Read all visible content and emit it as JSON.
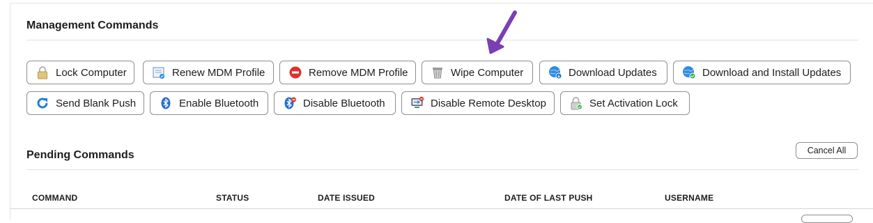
{
  "management": {
    "title": "Management Commands",
    "buttons": [
      {
        "label": "Lock Computer",
        "icon": "lock-icon"
      },
      {
        "label": "Renew MDM Profile",
        "icon": "certificate-icon"
      },
      {
        "label": "Remove MDM Profile",
        "icon": "no-entry-icon"
      },
      {
        "label": "Wipe Computer",
        "icon": "trash-icon"
      },
      {
        "label": "Download Updates",
        "icon": "globe-download-icon"
      },
      {
        "label": "Download and Install Updates",
        "icon": "globe-install-icon"
      },
      {
        "label": "Send Blank Push",
        "icon": "refresh-icon"
      },
      {
        "label": "Enable Bluetooth",
        "icon": "bluetooth-icon"
      },
      {
        "label": "Disable Bluetooth",
        "icon": "bluetooth-disabled-icon"
      },
      {
        "label": "Disable Remote Desktop",
        "icon": "remote-desktop-disabled-icon"
      },
      {
        "label": "Set Activation Lock",
        "icon": "activation-lock-icon"
      }
    ]
  },
  "pending": {
    "title": "Pending Commands",
    "cancel_all_label": "Cancel All",
    "columns": [
      "COMMAND",
      "STATUS",
      "DATE ISSUED",
      "DATE OF LAST PUSH",
      "USERNAME"
    ]
  },
  "annotation": {
    "arrow_color": "#7b3fb3"
  },
  "colors": {
    "border": "#8e8e93",
    "rule": "#e2e2e2"
  }
}
